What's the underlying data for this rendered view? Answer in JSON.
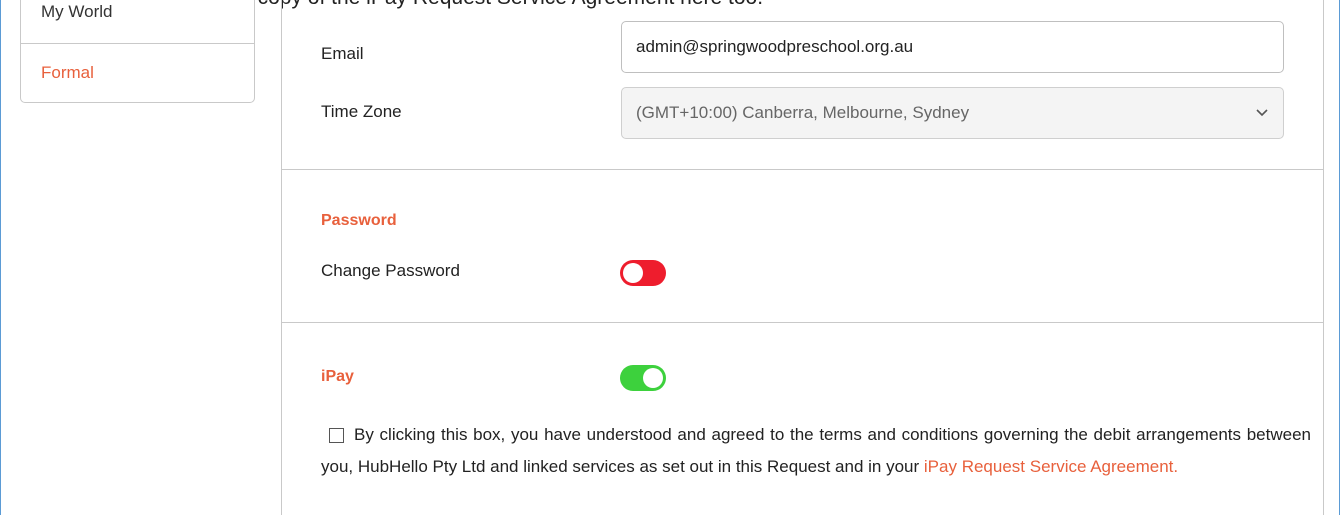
{
  "document": {
    "top_text": "also download a copy of the iPay Request Service Agreement here too."
  },
  "sidebar": {
    "items": [
      {
        "label": "My World"
      },
      {
        "label": "Formal"
      }
    ]
  },
  "account": {
    "email_label": "Email",
    "email_value": "admin@springwoodpreschool.org.au",
    "timezone_label": "Time Zone",
    "timezone_value": "(GMT+10:00) Canberra, Melbourne, Sydney"
  },
  "password": {
    "title": "Password",
    "change_label": "Change Password",
    "change_enabled": false
  },
  "ipay": {
    "title": "iPay",
    "enabled": true,
    "agreement_text": "By clicking this box, you have understood and agreed to the terms and conditions governing the debit arrangements between you, HubHello Pty Ltd and linked services as set out in this Request and in your",
    "agreement_link": "iPay Request Service Agreement."
  },
  "colors": {
    "accent": "#e8603c",
    "toggle_off": "#ee1d2d",
    "toggle_on": "#3dd13d",
    "frame_border": "#5b9bd5"
  },
  "icons": {
    "timezone_dropdown": "chevron-down-icon"
  }
}
